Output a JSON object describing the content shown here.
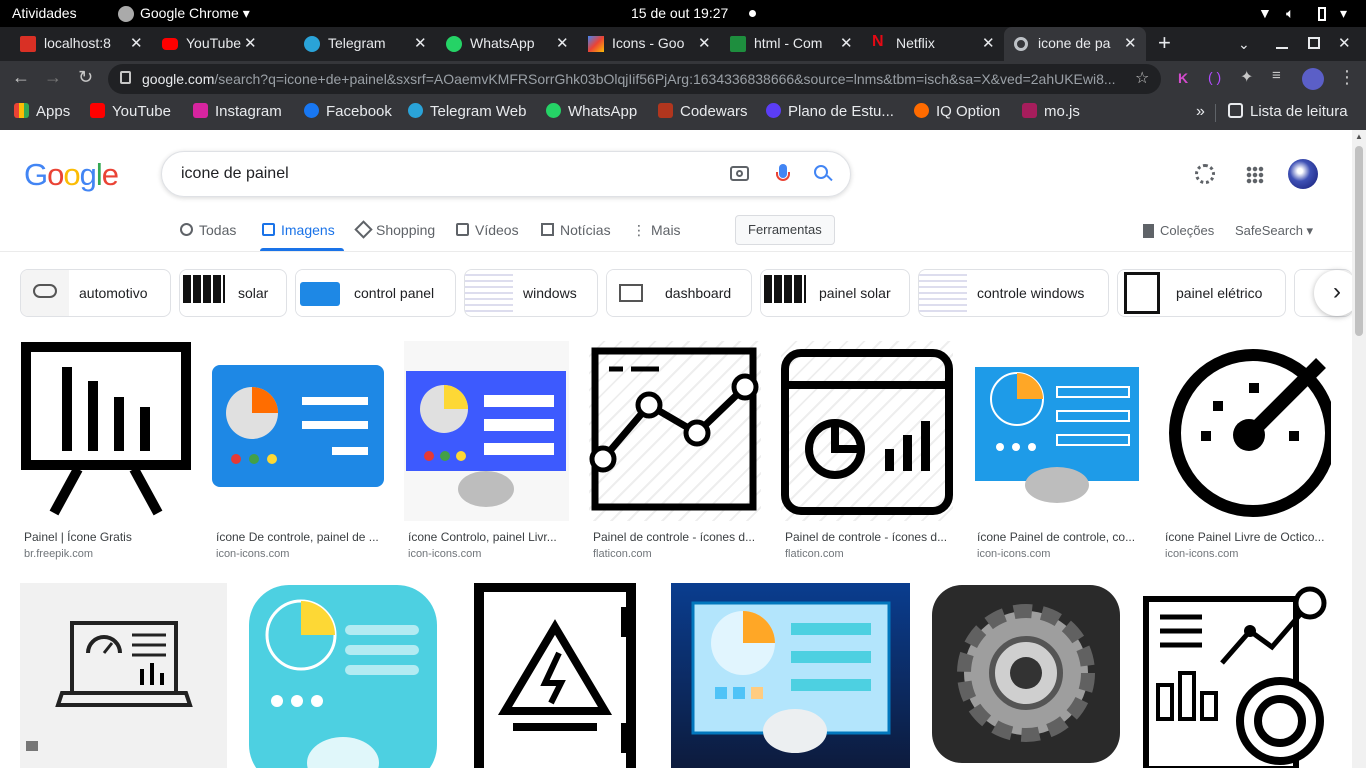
{
  "system_bar": {
    "activities": "Atividades",
    "app": "Google Chrome",
    "datetime": "15 de out  19:27"
  },
  "tabs": [
    {
      "title": "localhost:8",
      "icon": "localhost-icon"
    },
    {
      "title": "YouTube",
      "icon": "youtube-icon"
    },
    {
      "title": "Telegram",
      "icon": "telegram-icon"
    },
    {
      "title": "WhatsApp",
      "icon": "whatsapp-icon"
    },
    {
      "title": "Icons - Goo",
      "icon": "google-icons-icon"
    },
    {
      "title": "html - Com",
      "icon": "stackexchange-icon"
    },
    {
      "title": "Netflix",
      "icon": "netflix-icon"
    },
    {
      "title": "icone de pa",
      "icon": "google-icon"
    }
  ],
  "omnibox": {
    "url_host": "google.com",
    "url_path": "/search?q=icone+de+painel&sxsrf=AOaemvKMFRSorrGhk03bOlqjIif56PjArg:1634336838666&source=lnms&tbm=isch&sa=X&ved=2ahUKEwi8..."
  },
  "bookmarks": [
    {
      "label": "Apps",
      "color": "#ea4335"
    },
    {
      "label": "YouTube",
      "color": "#ff0000"
    },
    {
      "label": "Instagram",
      "color": "#d6249f"
    },
    {
      "label": "Facebook",
      "color": "#1877f2"
    },
    {
      "label": "Telegram Web",
      "color": "#2aa3d8"
    },
    {
      "label": "WhatsApp",
      "color": "#25d366"
    },
    {
      "label": "Codewars",
      "color": "#b1361e"
    },
    {
      "label": "Plano de Estu...",
      "color": "#5b3df5"
    },
    {
      "label": "IQ Option",
      "color": "#ff6b00"
    },
    {
      "label": "mo.js",
      "color": "#a61d5c"
    }
  ],
  "reading_list": "Lista de leitura",
  "search": {
    "query": "icone de painel"
  },
  "search_tabs": [
    "Todas",
    "Imagens",
    "Shopping",
    "Vídeos",
    "Notícias",
    "Mais"
  ],
  "tools_button": "Ferramentas",
  "collections": "Coleções",
  "safesearch": "SafeSearch",
  "chips": [
    "automotivo",
    "solar",
    "control panel",
    "windows",
    "dashboard",
    "painel solar",
    "controle windows",
    "painel elétrico"
  ],
  "results_row1": [
    {
      "caption": "Painel | Ícone Gratis",
      "source": "br.freepik.com"
    },
    {
      "caption": "ícone De controle, painel de ...",
      "source": "icon-icons.com"
    },
    {
      "caption": "ícone Controlo, painel Livr...",
      "source": "icon-icons.com"
    },
    {
      "caption": "Painel de controle - ícones d...",
      "source": "flaticon.com"
    },
    {
      "caption": "Painel de controle - ícones d...",
      "source": "flaticon.com"
    },
    {
      "caption": "ícone Painel de controle, co...",
      "source": "icon-icons.com"
    },
    {
      "caption": "ícone Painel Livre de Octico...",
      "source": "icon-icons.com"
    }
  ]
}
